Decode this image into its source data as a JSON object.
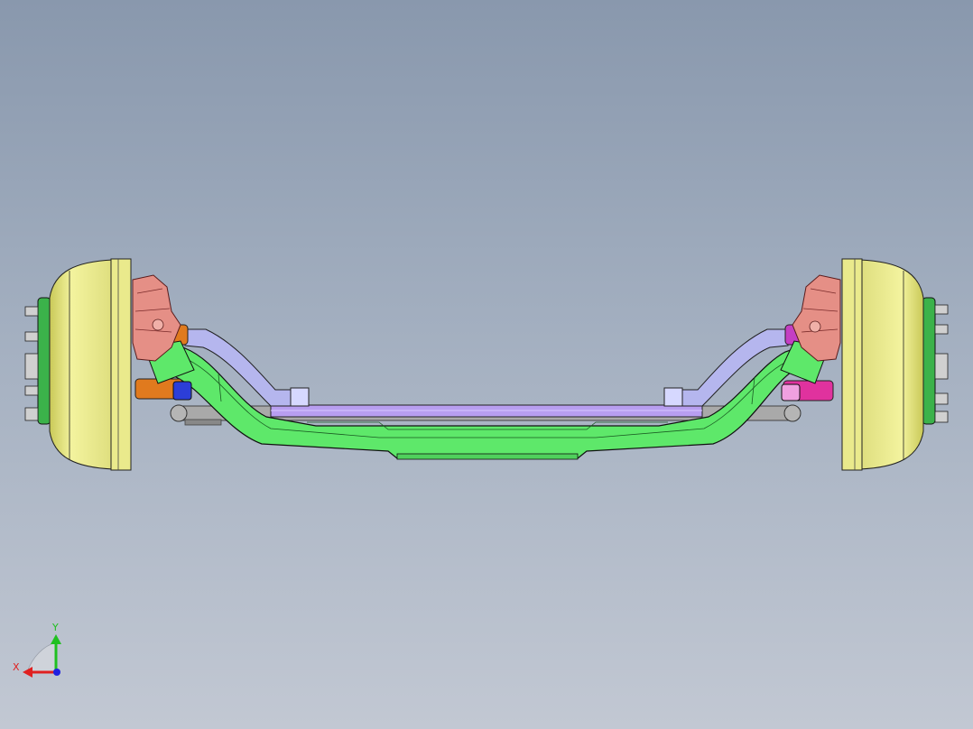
{
  "viewport": {
    "background_top": "#8998ad",
    "background_bottom": "#c2c8d3"
  },
  "model": {
    "part_colors": {
      "brake_drum": "#e8e88a",
      "wheel_hub": "#3bb24a",
      "brake_chamber": "#e58f86",
      "axle_beam": "#5ee86a",
      "tie_rod": "#b89ef0",
      "steering_arm": "#b5b6ee",
      "knuckle_arm_left_end": "#e07a1e",
      "knuckle_arm_right_end": "#e0329e",
      "fitting_left": "#2c3ed8",
      "fitting_right": "#f0a0e0",
      "shock_tube": "#a9a9a9"
    }
  },
  "triad": {
    "x_label": "X",
    "y_label": "Y",
    "x_color": "#e02020",
    "y_color": "#20c020",
    "z_color": "#2020e0"
  }
}
